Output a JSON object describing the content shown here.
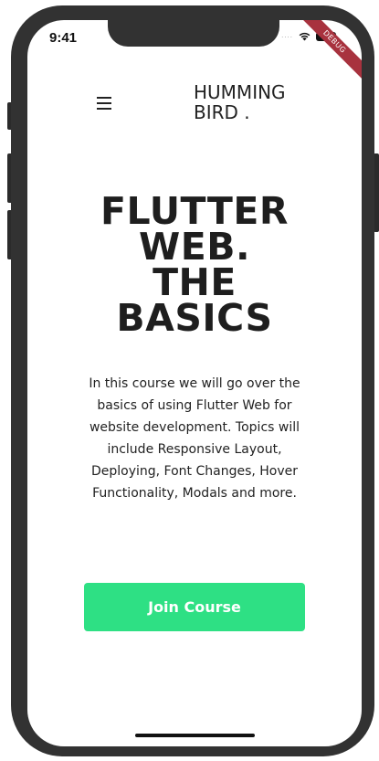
{
  "status_bar": {
    "time": "9:41",
    "signal_dots": "....",
    "wifi_icon": "wifi-icon",
    "battery_icon": "battery-icon"
  },
  "debug_banner": {
    "label": "DEBUG",
    "color": "#a8323e"
  },
  "nav": {
    "menu_icon": "hamburger-menu-icon",
    "brand": "HUMMING\nBIRD ."
  },
  "hero": {
    "headline_lines": [
      "FLUTTER",
      "WEB.",
      "THE",
      "BASICS"
    ],
    "description": "In this course we will go over the basics of using Flutter Web for website development. Topics will include Responsive Layout, Deploying, Font Changes, Hover Functionality, Modals and more."
  },
  "cta": {
    "label": "Join Course",
    "color": "#2ee084"
  }
}
